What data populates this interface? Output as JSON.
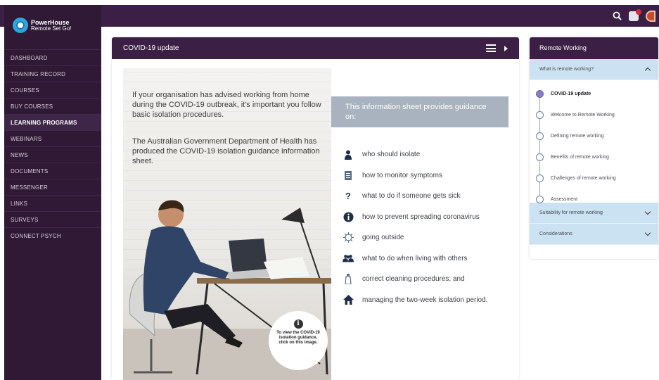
{
  "brand": {
    "name": "PowerHouse",
    "tagline": "Remote Set Go!"
  },
  "topbar": {
    "icons": [
      "search-icon",
      "notification-bell-icon",
      "user-avatar"
    ]
  },
  "sidebar": {
    "items": [
      {
        "label": "DASHBOARD"
      },
      {
        "label": "TRAINING RECORD"
      },
      {
        "label": "COURSES"
      },
      {
        "label": "BUY COURSES"
      },
      {
        "label": "LEARNING PROGRAMS",
        "active": true
      },
      {
        "label": "WEBINARS"
      },
      {
        "label": "NEWS"
      },
      {
        "label": "DOCUMENTS"
      },
      {
        "label": "MESSENGER"
      },
      {
        "label": "LINKS"
      },
      {
        "label": "SURVEYS"
      },
      {
        "label": "CONNECT PSYCH"
      }
    ]
  },
  "content": {
    "title": "COVID-19 update",
    "paragraph1": "If your organisation has advised working from home during the COVID-19 outbreak, it's important you follow basic isolation procedures.",
    "paragraph2": "The Australian Government Department of Health has produced the COVID-19 isolation guidance information sheet.",
    "cta": "To view the COVID-19 isolation guidance, click on this image.",
    "guide_heading": "This information sheet provides guidance on:",
    "guide_items": [
      {
        "icon": "person-icon",
        "label": "who should isolate"
      },
      {
        "icon": "clipboard-icon",
        "label": "how to monitor symptoms"
      },
      {
        "icon": "question-icon",
        "label": "what to do if someone gets sick"
      },
      {
        "icon": "info-icon",
        "label": "how to prevent spreading coronavirus"
      },
      {
        "icon": "virus-icon",
        "label": "going outside"
      },
      {
        "icon": "people-icon",
        "label": "what to do when living with others"
      },
      {
        "icon": "spray-bottle-icon",
        "label": "correct cleaning procedures; and"
      },
      {
        "icon": "house-icon",
        "label": "managing the two-week isolation period."
      }
    ]
  },
  "remote": {
    "title": "Remote Working",
    "section1": "What is remote working?",
    "steps": [
      {
        "label": "COVID-19 update",
        "current": true
      },
      {
        "label": "Welcome to Remote Working"
      },
      {
        "label": "Defining remote working"
      },
      {
        "label": "Benefits of remote working"
      },
      {
        "label": "Challenges of remote working"
      },
      {
        "label": "Assessment"
      }
    ],
    "section2": "Suitability for remote working",
    "section3": "Considerations"
  },
  "colors": {
    "primary": "#3b1f44",
    "sidebar": "#2f1934",
    "accordion": "#cbe2f2",
    "guide_box": "#a9b3bf"
  }
}
